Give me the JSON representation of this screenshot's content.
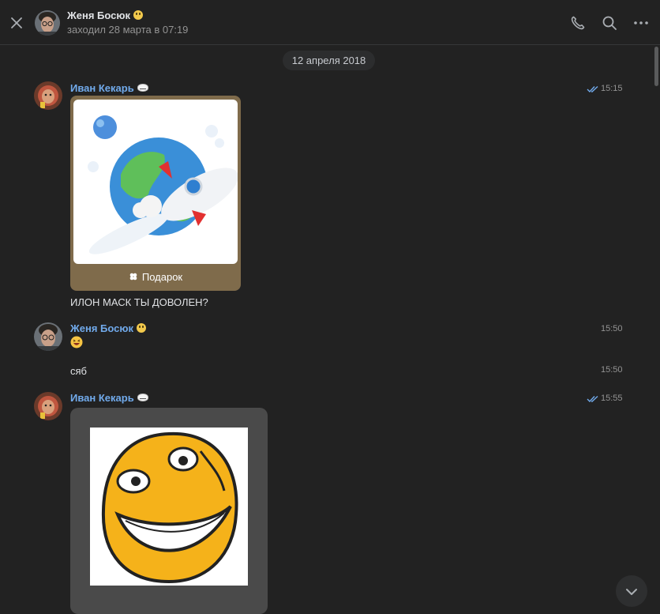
{
  "header": {
    "name": "Женя Босюк",
    "status": "заходил 28 марта в 07:19",
    "icons": [
      "close-icon",
      "phone-icon",
      "search-icon",
      "more-icon"
    ]
  },
  "date_divider": "12 апреля 2018",
  "messages": [
    {
      "author": "Иван Кекарь",
      "author_emoji": "troll-face",
      "time": "15:15",
      "read": true,
      "attachment": {
        "type": "gift",
        "label": "Подарок",
        "image": "globe-with-rocket"
      },
      "text": "ИЛОН МАСК ТЫ ДОВОЛЕН?"
    },
    {
      "author": "Женя Босюк",
      "author_emoji": "cat-face",
      "time": "15:50",
      "text_emoji": "laughing-face"
    },
    {
      "author": "Женя Босюк",
      "time": "15:50",
      "text": "сяб"
    },
    {
      "author": "Иван Кекарь",
      "author_emoji": "troll-face",
      "time": "15:55",
      "read": true,
      "attachment": {
        "type": "sticker",
        "image": "grinning-meme-face"
      }
    }
  ],
  "colors": {
    "background": "#222222",
    "author_link": "#71aaeb",
    "gift_card": "#7f6b4b",
    "muted_text": "#939393"
  }
}
